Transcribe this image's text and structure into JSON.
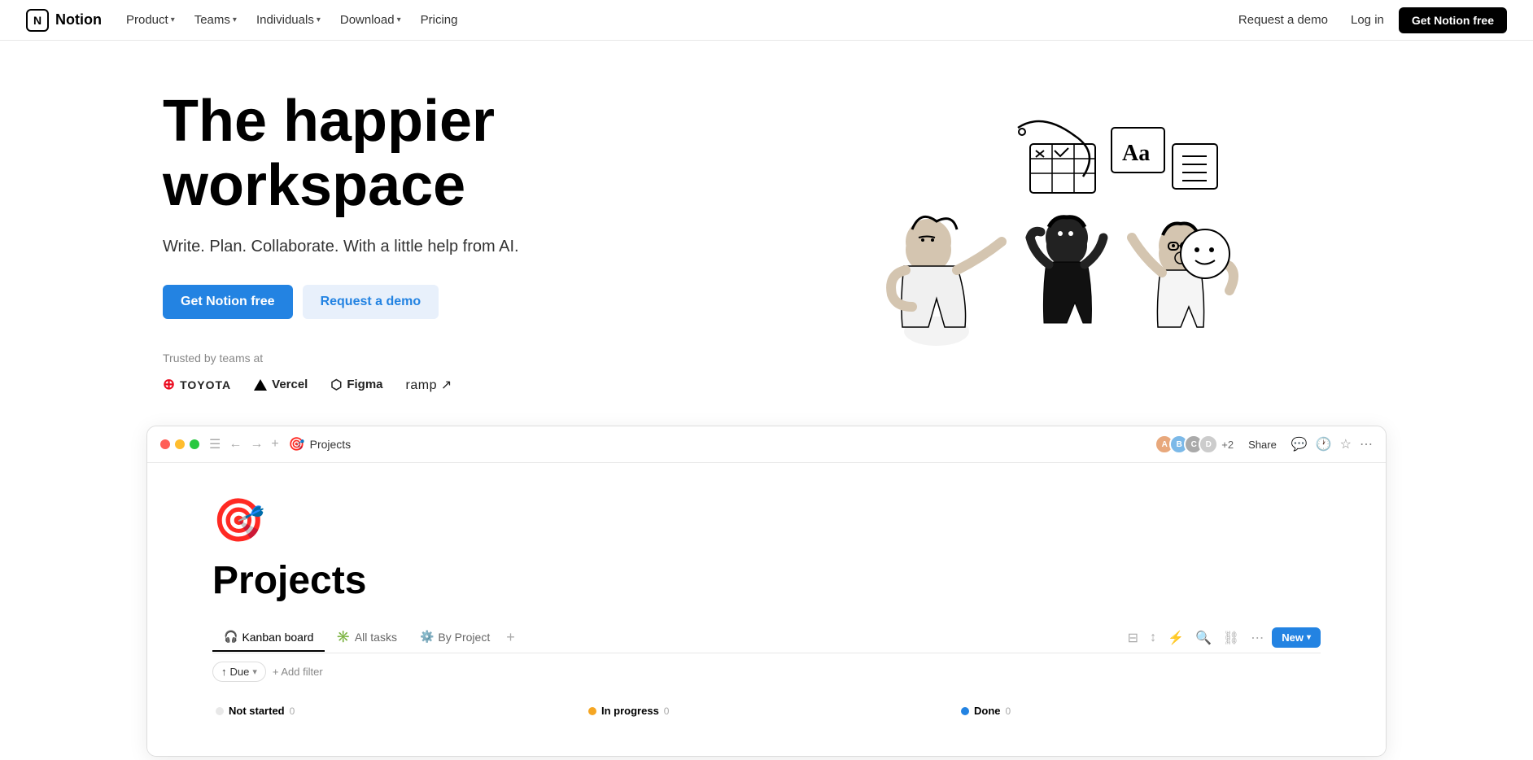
{
  "nav": {
    "logo_text": "Notion",
    "logo_letter": "N",
    "items": [
      {
        "label": "Product",
        "has_chevron": true
      },
      {
        "label": "Teams",
        "has_chevron": true
      },
      {
        "label": "Individuals",
        "has_chevron": true
      },
      {
        "label": "Download",
        "has_chevron": true
      },
      {
        "label": "Pricing",
        "has_chevron": false
      }
    ],
    "request_demo": "Request a demo",
    "login": "Log in",
    "get_free": "Get Notion free"
  },
  "hero": {
    "title_line1": "The happier",
    "title_line2": "workspace",
    "subtitle": "Write. Plan. Collaborate. With a little help from AI.",
    "btn_primary": "Get Notion free",
    "btn_secondary": "Request a demo",
    "trusted_label": "Trusted by teams at",
    "logos": [
      {
        "name": "TOYOTA",
        "type": "toyota"
      },
      {
        "name": "Vercel",
        "type": "vercel"
      },
      {
        "name": "Figma",
        "type": "figma"
      },
      {
        "name": "ramp",
        "type": "ramp"
      }
    ]
  },
  "app_window": {
    "breadcrumb": "Projects",
    "share_label": "Share",
    "avatar_count": "+2",
    "page_icon": "🎯",
    "page_title": "Projects",
    "tabs": [
      {
        "label": "Kanban board",
        "icon": "🎧",
        "active": true
      },
      {
        "label": "All tasks",
        "icon": "✳️",
        "active": false
      },
      {
        "label": "By Project",
        "icon": "⚙️",
        "active": false
      }
    ],
    "new_label": "New",
    "filter_due": "Due",
    "add_filter": "+ Add filter",
    "kanban_columns": [
      {
        "label": "Not started",
        "status": "not-started",
        "count": "0",
        "color": "#e8e8e8"
      },
      {
        "label": "In progress",
        "status": "in-progress",
        "count": "0",
        "color": "#f5a623"
      },
      {
        "label": "Done",
        "status": "done",
        "count": "0",
        "color": "#2383e2"
      }
    ]
  }
}
